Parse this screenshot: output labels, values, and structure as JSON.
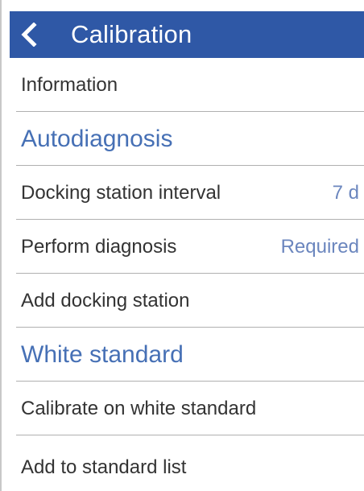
{
  "header": {
    "title": "Calibration",
    "back_icon": "chevron-left-icon"
  },
  "rows": [
    {
      "label": "Information",
      "value": ""
    },
    {
      "label": "Autodiagnosis"
    },
    {
      "label": "Docking station interval",
      "value": "7 d"
    },
    {
      "label": "Perform diagnosis",
      "value": "Required"
    },
    {
      "label": "Add docking station",
      "value": ""
    },
    {
      "label": "White standard"
    },
    {
      "label": "Calibrate on white standard",
      "value": ""
    },
    {
      "label": "Add to standard list",
      "value": ""
    }
  ],
  "colors": {
    "header_bg": "#2f58a6",
    "header_text": "#ffffff",
    "section_text": "#4670b5",
    "item_text": "#333333",
    "value_text": "#6b86be",
    "divider": "#b0b0b0"
  }
}
